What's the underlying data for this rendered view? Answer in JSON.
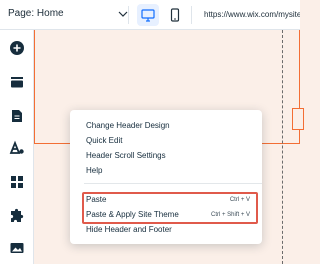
{
  "topbar": {
    "page_selector": "Page: Home",
    "url": "https://www.wix.com/mysite",
    "devices": [
      {
        "name": "desktop",
        "icon": "desktop-icon",
        "active": true
      },
      {
        "name": "mobile",
        "icon": "mobile-icon",
        "active": false
      }
    ]
  },
  "sidebar": {
    "icons": [
      "add-icon",
      "pages-icon",
      "page-icon",
      "theme-icon",
      "apps-icon",
      "puzzle-icon",
      "media-icon"
    ]
  },
  "context_menu": {
    "items": [
      {
        "label": "Change Header Design",
        "shortcut": ""
      },
      {
        "label": "Quick Edit",
        "shortcut": ""
      },
      {
        "label": "Header Scroll Settings",
        "shortcut": ""
      },
      {
        "label": "Help",
        "shortcut": ""
      },
      {
        "label": "Paste",
        "shortcut": "Ctrl + V"
      },
      {
        "label": "Paste & Apply Site Theme",
        "shortcut": "Ctrl + Shift + V"
      },
      {
        "label": "Hide Header and Footer",
        "shortcut": ""
      }
    ]
  },
  "colors": {
    "canvas": "#fbefe8",
    "header_border": "#f36e34",
    "highlight": "#e05a4b",
    "accent": "#116dff"
  }
}
